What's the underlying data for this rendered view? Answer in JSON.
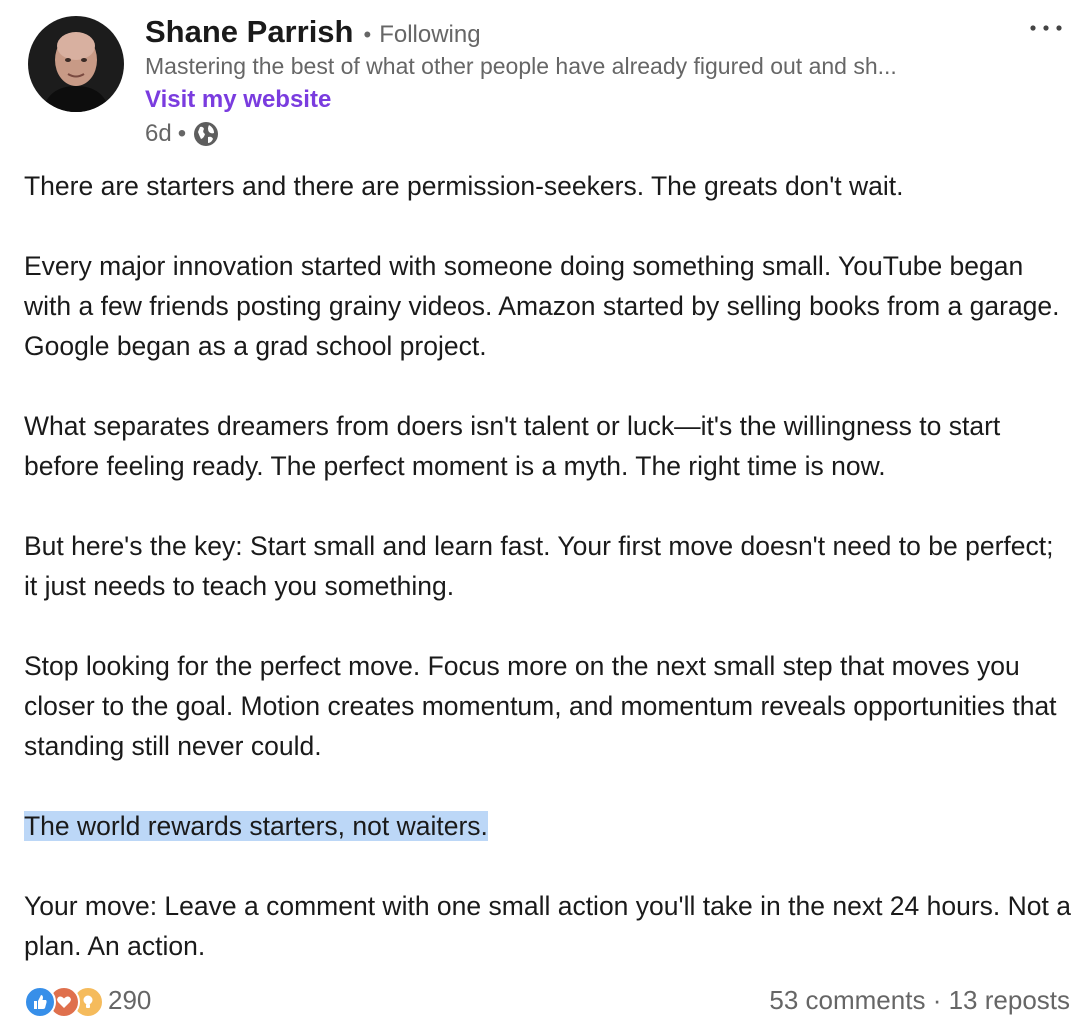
{
  "author": {
    "name": "Shane Parrish",
    "follow_status": "Following",
    "headline": "Mastering the best of what other people have already figured out and sh...",
    "website_label": "Visit my website",
    "time_ago": "6d"
  },
  "post": {
    "paragraphs": [
      "There are starters and there are permission-seekers. The greats don't wait.",
      "Every major innovation started with someone doing something small. YouTube began with a few friends posting grainy videos. Amazon started by selling books from a garage. Google began as a grad school project.",
      "What separates dreamers from doers isn't talent or luck—it's the willingness to start before feeling ready. The perfect moment is a myth. The right time is now.",
      "But here's the key: Start small and learn fast. Your first move doesn't need to be perfect; it just needs to teach you something.",
      "Stop looking for the perfect move. Focus more on the next small step that moves you closer to the goal. Motion creates momentum, and momentum reveals opportunities that standing still never could.",
      "The world rewards starters, not waiters.",
      "Your move: Leave a comment with one small action you'll take in the next 24 hours. Not a plan. An action."
    ]
  },
  "stats": {
    "reactions_count": "290",
    "comments": "53 comments",
    "separator": "·",
    "reposts": "13 reposts"
  },
  "icons": {
    "reactions": [
      "like-icon",
      "love-icon",
      "insightful-icon"
    ],
    "visibility": "globe-icon",
    "menu": "more-options-icon"
  },
  "colors": {
    "link": "#7a3cdf",
    "highlight": "#bcd7f7",
    "like": "#378fe9",
    "love": "#df704d",
    "insightful": "#f5bb5c"
  }
}
